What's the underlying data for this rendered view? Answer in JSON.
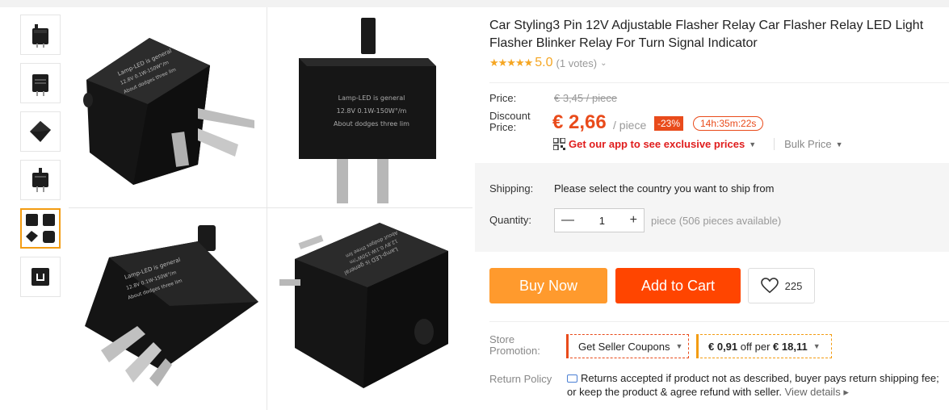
{
  "product": {
    "title": "Car Styling3 Pin 12V Adjustable Flasher Relay Car Flasher Relay LED Light Flasher Blinker Relay For Turn Signal Indicator",
    "rating_stars": "★★★★★",
    "rating": "5.0",
    "votes": "(1 votes)",
    "votes_chevron": "⌄"
  },
  "gallery": {
    "label_line1": "Lamp-LED is general",
    "label_line2": "12.8V 0.1W-150W°/m",
    "label_line3": "About dodges three lim"
  },
  "price": {
    "price_label": "Price:",
    "old_price": "€ 3,45 / piece",
    "discount_label": "Discount Price:",
    "price": "€ 2,66",
    "per": "/ piece",
    "discount": "-23%",
    "timer": "14h:35m:22s",
    "app_promo": "Get our app to see exclusive prices",
    "app_chevron": "▼",
    "bulk": "Bulk Price",
    "bulk_chevron": "▼"
  },
  "shipping": {
    "label": "Shipping:",
    "text": "Please select the country you want to ship from"
  },
  "quantity": {
    "label": "Quantity:",
    "minus": "—",
    "value": "1",
    "plus": "+",
    "available": "piece (506 pieces available)"
  },
  "actions": {
    "buy_now": "Buy Now",
    "add_to_cart": "Add to Cart",
    "wishlist_count": "225"
  },
  "promotion": {
    "label": "Store Promotion:",
    "coupon": "Get Seller Coupons",
    "offer_amount": "€ 0,91",
    "offer_mid": "off per",
    "offer_min": "€ 18,11",
    "chevron": "▼"
  },
  "return_policy": {
    "label": "Return Policy",
    "text": "Returns accepted if product not as described, buyer pays return shipping fee; or keep the product & agree refund with seller.",
    "link": "View details",
    "link_arrow": "▸"
  },
  "colors": {
    "accent_red": "#e94b1b",
    "buy_orange": "#ff9a2d",
    "cart_red": "#ff4500",
    "star": "#f5a623"
  }
}
